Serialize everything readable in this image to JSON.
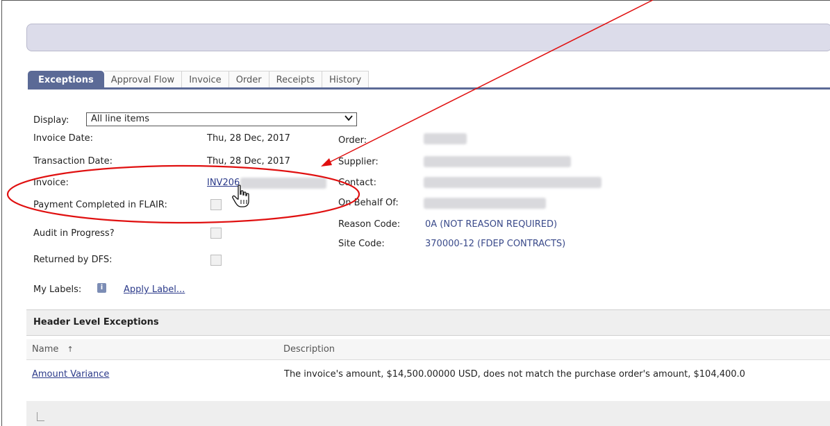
{
  "tabs": [
    {
      "label": "Exceptions",
      "active": true
    },
    {
      "label": "Approval Flow"
    },
    {
      "label": "Invoice"
    },
    {
      "label": "Order"
    },
    {
      "label": "Receipts"
    },
    {
      "label": "History"
    }
  ],
  "display": {
    "label": "Display:",
    "value": "All line items"
  },
  "left_fields": {
    "invoice_date_label": "Invoice Date:",
    "invoice_date_value": "Thu, 28 Dec, 2017",
    "transaction_date_label": "Transaction Date:",
    "transaction_date_value": "Thu, 28 Dec, 2017",
    "invoice_label": "Invoice:",
    "invoice_value": "INV206",
    "payment_completed_label": "Payment Completed in FLAIR:",
    "audit_label": "Audit in Progress?",
    "returned_label": "Returned by DFS:"
  },
  "right_fields": {
    "order_label": "Order:",
    "supplier_label": "Supplier:",
    "contact_label": "Contact:",
    "on_behalf_label": "On Behalf Of:",
    "reason_code_label": "Reason Code:",
    "reason_code_value": "0A (NOT REASON REQUIRED)",
    "site_code_label": "Site Code:",
    "site_code_value": "370000-12 (FDEP CONTRACTS)"
  },
  "labels": {
    "my_labels": "My Labels:",
    "info_icon": "i",
    "apply_label": "Apply Label..."
  },
  "exceptions_section": {
    "title": "Header Level Exceptions",
    "columns": [
      "Name",
      "Description"
    ],
    "sort_indicator": "↑",
    "rows": [
      {
        "name": "Amount Variance",
        "description": "The invoice's amount, $14,500.00000 USD, does not match the purchase order's amount, $104,400.0"
      }
    ]
  },
  "colors": {
    "accent": "#5b6a96",
    "annotation": "#e01010",
    "link": "#2b3a8a"
  }
}
